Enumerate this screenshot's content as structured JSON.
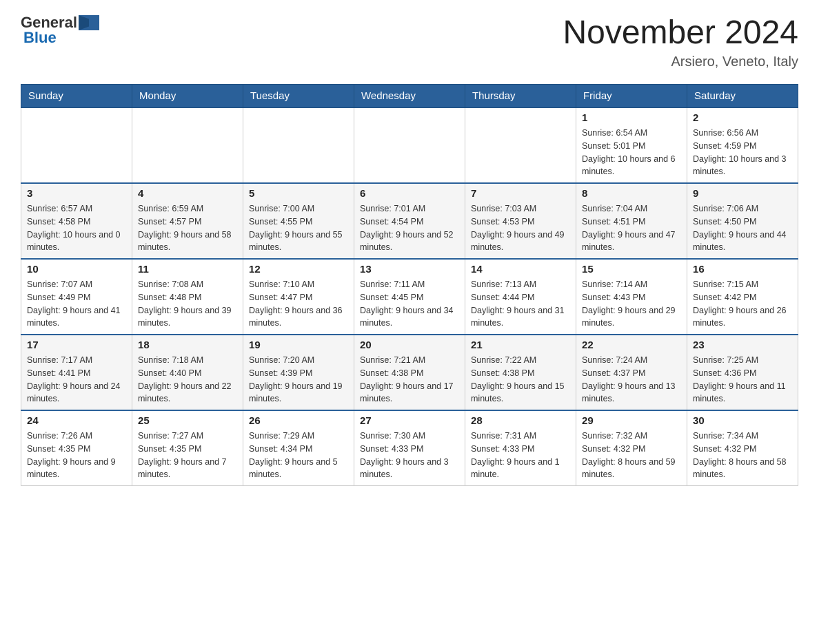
{
  "header": {
    "logo_general": "General",
    "logo_blue": "Blue",
    "month_title": "November 2024",
    "location": "Arsiero, Veneto, Italy"
  },
  "weekdays": [
    "Sunday",
    "Monday",
    "Tuesday",
    "Wednesday",
    "Thursday",
    "Friday",
    "Saturday"
  ],
  "rows": [
    [
      {
        "day": "",
        "sunrise": "",
        "sunset": "",
        "daylight": ""
      },
      {
        "day": "",
        "sunrise": "",
        "sunset": "",
        "daylight": ""
      },
      {
        "day": "",
        "sunrise": "",
        "sunset": "",
        "daylight": ""
      },
      {
        "day": "",
        "sunrise": "",
        "sunset": "",
        "daylight": ""
      },
      {
        "day": "",
        "sunrise": "",
        "sunset": "",
        "daylight": ""
      },
      {
        "day": "1",
        "sunrise": "Sunrise: 6:54 AM",
        "sunset": "Sunset: 5:01 PM",
        "daylight": "Daylight: 10 hours and 6 minutes."
      },
      {
        "day": "2",
        "sunrise": "Sunrise: 6:56 AM",
        "sunset": "Sunset: 4:59 PM",
        "daylight": "Daylight: 10 hours and 3 minutes."
      }
    ],
    [
      {
        "day": "3",
        "sunrise": "Sunrise: 6:57 AM",
        "sunset": "Sunset: 4:58 PM",
        "daylight": "Daylight: 10 hours and 0 minutes."
      },
      {
        "day": "4",
        "sunrise": "Sunrise: 6:59 AM",
        "sunset": "Sunset: 4:57 PM",
        "daylight": "Daylight: 9 hours and 58 minutes."
      },
      {
        "day": "5",
        "sunrise": "Sunrise: 7:00 AM",
        "sunset": "Sunset: 4:55 PM",
        "daylight": "Daylight: 9 hours and 55 minutes."
      },
      {
        "day": "6",
        "sunrise": "Sunrise: 7:01 AM",
        "sunset": "Sunset: 4:54 PM",
        "daylight": "Daylight: 9 hours and 52 minutes."
      },
      {
        "day": "7",
        "sunrise": "Sunrise: 7:03 AM",
        "sunset": "Sunset: 4:53 PM",
        "daylight": "Daylight: 9 hours and 49 minutes."
      },
      {
        "day": "8",
        "sunrise": "Sunrise: 7:04 AM",
        "sunset": "Sunset: 4:51 PM",
        "daylight": "Daylight: 9 hours and 47 minutes."
      },
      {
        "day": "9",
        "sunrise": "Sunrise: 7:06 AM",
        "sunset": "Sunset: 4:50 PM",
        "daylight": "Daylight: 9 hours and 44 minutes."
      }
    ],
    [
      {
        "day": "10",
        "sunrise": "Sunrise: 7:07 AM",
        "sunset": "Sunset: 4:49 PM",
        "daylight": "Daylight: 9 hours and 41 minutes."
      },
      {
        "day": "11",
        "sunrise": "Sunrise: 7:08 AM",
        "sunset": "Sunset: 4:48 PM",
        "daylight": "Daylight: 9 hours and 39 minutes."
      },
      {
        "day": "12",
        "sunrise": "Sunrise: 7:10 AM",
        "sunset": "Sunset: 4:47 PM",
        "daylight": "Daylight: 9 hours and 36 minutes."
      },
      {
        "day": "13",
        "sunrise": "Sunrise: 7:11 AM",
        "sunset": "Sunset: 4:45 PM",
        "daylight": "Daylight: 9 hours and 34 minutes."
      },
      {
        "day": "14",
        "sunrise": "Sunrise: 7:13 AM",
        "sunset": "Sunset: 4:44 PM",
        "daylight": "Daylight: 9 hours and 31 minutes."
      },
      {
        "day": "15",
        "sunrise": "Sunrise: 7:14 AM",
        "sunset": "Sunset: 4:43 PM",
        "daylight": "Daylight: 9 hours and 29 minutes."
      },
      {
        "day": "16",
        "sunrise": "Sunrise: 7:15 AM",
        "sunset": "Sunset: 4:42 PM",
        "daylight": "Daylight: 9 hours and 26 minutes."
      }
    ],
    [
      {
        "day": "17",
        "sunrise": "Sunrise: 7:17 AM",
        "sunset": "Sunset: 4:41 PM",
        "daylight": "Daylight: 9 hours and 24 minutes."
      },
      {
        "day": "18",
        "sunrise": "Sunrise: 7:18 AM",
        "sunset": "Sunset: 4:40 PM",
        "daylight": "Daylight: 9 hours and 22 minutes."
      },
      {
        "day": "19",
        "sunrise": "Sunrise: 7:20 AM",
        "sunset": "Sunset: 4:39 PM",
        "daylight": "Daylight: 9 hours and 19 minutes."
      },
      {
        "day": "20",
        "sunrise": "Sunrise: 7:21 AM",
        "sunset": "Sunset: 4:38 PM",
        "daylight": "Daylight: 9 hours and 17 minutes."
      },
      {
        "day": "21",
        "sunrise": "Sunrise: 7:22 AM",
        "sunset": "Sunset: 4:38 PM",
        "daylight": "Daylight: 9 hours and 15 minutes."
      },
      {
        "day": "22",
        "sunrise": "Sunrise: 7:24 AM",
        "sunset": "Sunset: 4:37 PM",
        "daylight": "Daylight: 9 hours and 13 minutes."
      },
      {
        "day": "23",
        "sunrise": "Sunrise: 7:25 AM",
        "sunset": "Sunset: 4:36 PM",
        "daylight": "Daylight: 9 hours and 11 minutes."
      }
    ],
    [
      {
        "day": "24",
        "sunrise": "Sunrise: 7:26 AM",
        "sunset": "Sunset: 4:35 PM",
        "daylight": "Daylight: 9 hours and 9 minutes."
      },
      {
        "day": "25",
        "sunrise": "Sunrise: 7:27 AM",
        "sunset": "Sunset: 4:35 PM",
        "daylight": "Daylight: 9 hours and 7 minutes."
      },
      {
        "day": "26",
        "sunrise": "Sunrise: 7:29 AM",
        "sunset": "Sunset: 4:34 PM",
        "daylight": "Daylight: 9 hours and 5 minutes."
      },
      {
        "day": "27",
        "sunrise": "Sunrise: 7:30 AM",
        "sunset": "Sunset: 4:33 PM",
        "daylight": "Daylight: 9 hours and 3 minutes."
      },
      {
        "day": "28",
        "sunrise": "Sunrise: 7:31 AM",
        "sunset": "Sunset: 4:33 PM",
        "daylight": "Daylight: 9 hours and 1 minute."
      },
      {
        "day": "29",
        "sunrise": "Sunrise: 7:32 AM",
        "sunset": "Sunset: 4:32 PM",
        "daylight": "Daylight: 8 hours and 59 minutes."
      },
      {
        "day": "30",
        "sunrise": "Sunrise: 7:34 AM",
        "sunset": "Sunset: 4:32 PM",
        "daylight": "Daylight: 8 hours and 58 minutes."
      }
    ]
  ]
}
